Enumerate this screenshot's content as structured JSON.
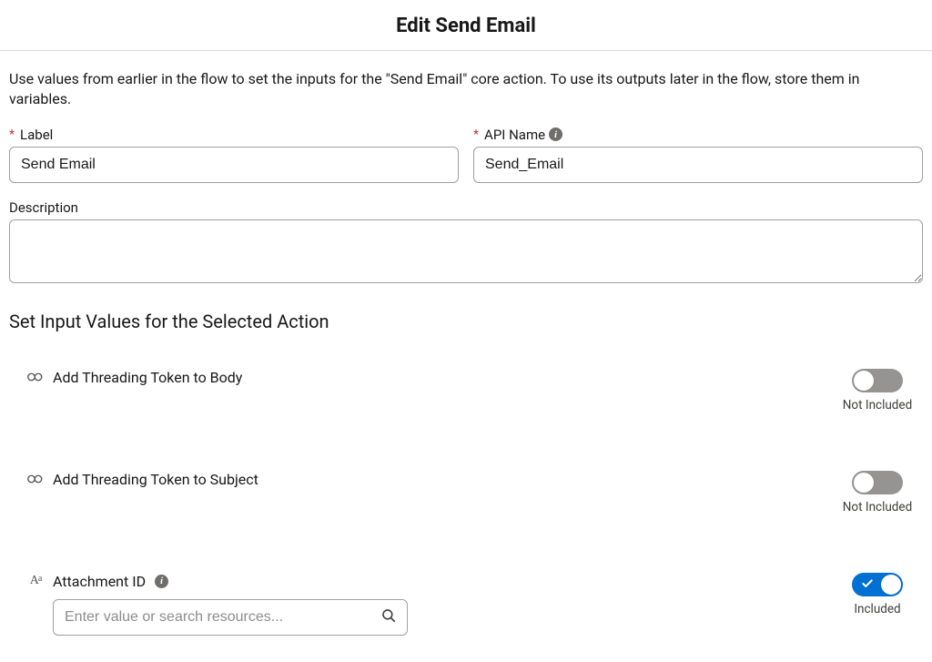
{
  "header": {
    "title": "Edit Send Email"
  },
  "intro": "Use values from earlier in the flow to set the inputs for the \"Send Email\" core action. To use its outputs later in the flow, store them in variables.",
  "fields": {
    "label": {
      "label": "Label",
      "value": "Send Email",
      "required": true
    },
    "apiName": {
      "label": "API Name",
      "value": "Send_Email",
      "required": true
    },
    "description": {
      "label": "Description",
      "value": ""
    }
  },
  "section": {
    "title": "Set Input Values for the Selected Action"
  },
  "params": {
    "threadBody": {
      "label": "Add Threading Token to Body",
      "status": "Not Included",
      "on": false
    },
    "threadSubject": {
      "label": "Add Threading Token to Subject",
      "status": "Not Included",
      "on": false
    },
    "attachmentId": {
      "label": "Attachment ID",
      "placeholder": "Enter value or search resources...",
      "status": "Included",
      "on": true
    }
  }
}
